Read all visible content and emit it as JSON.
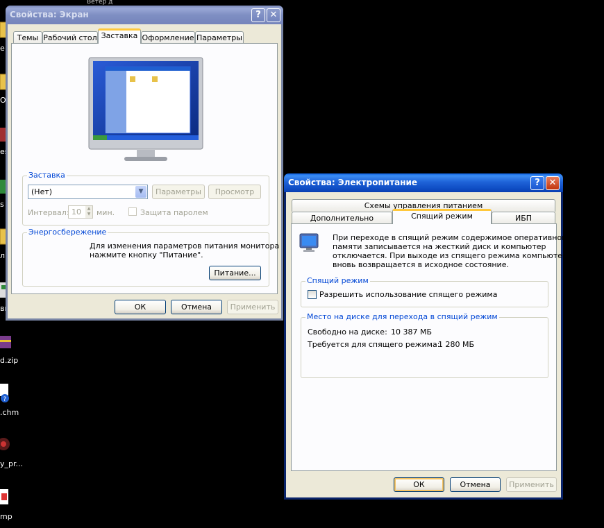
{
  "desktop": {
    "top_text": "Ветер д",
    "icons": [
      {
        "label": "е"
      },
      {
        "label": "Ол"
      },
      {
        "label": "es"
      },
      {
        "label": "s"
      },
      {
        "label": "л"
      },
      {
        "label": "вь"
      },
      {
        "label": "d.zip"
      },
      {
        "label": ".chm"
      },
      {
        "label": "y_pr..."
      },
      {
        "label": "mp"
      }
    ]
  },
  "display_dialog": {
    "title": "Свойства: Экран",
    "help_label": "?",
    "close_label": "✕",
    "tabs": [
      "Темы",
      "Рабочий стол",
      "Заставка",
      "Оформление",
      "Параметры"
    ],
    "selected_tab": "Заставка",
    "screensaver": {
      "group_title": "Заставка",
      "select_value": "(Нет)",
      "settings_label": "Параметры",
      "preview_label": "Просмотр",
      "interval_label": "Интервал:",
      "interval_value": "10",
      "interval_unit": "мин.",
      "password_label": "Защита паролем"
    },
    "energy": {
      "group_title": "Энергосбережение",
      "text_line1": "Для изменения параметров питания монитора",
      "text_line2": "нажмите кнопку \"Питание\".",
      "power_label": "Питание..."
    },
    "ok_label": "ОК",
    "cancel_label": "Отмена",
    "apply_label": "Применить"
  },
  "power_dialog": {
    "title": "Свойства: Электропитание",
    "help_label": "?",
    "close_label": "✕",
    "tabs_row1": [
      "Схемы управления питанием"
    ],
    "tabs_row2": [
      "Дополнительно",
      "Спящий режим",
      "ИБП"
    ],
    "selected_tab": "Спящий режим",
    "info_line1": "При переходе в спящий режим содержимое оперативной",
    "info_line2": "памяти записывается на жесткий диск и компьютер",
    "info_line3": "отключается. При выходе из спящего режима компьютер",
    "info_line4": "вновь возвращается в исходное состояние.",
    "hibernate_group_title": "Спящий режим",
    "hibernate_checkbox_label": "Разрешить использование спящего режима",
    "disk_group_title": "Место на диске для перехода в спящий режим",
    "free_label": "Свободно на диске:",
    "free_value": "10 387 МБ",
    "required_label": "Требуется для спящего режима:",
    "required_value": "1 280 МБ",
    "ok_label": "ОК",
    "cancel_label": "Отмена",
    "apply_label": "Применить"
  },
  "colors": {
    "xp_blue_title": "#0a5fe0",
    "group_title_blue": "#0046d5",
    "dialog_face": "#ece9d8",
    "tab_highlight": "#ffc83c"
  }
}
